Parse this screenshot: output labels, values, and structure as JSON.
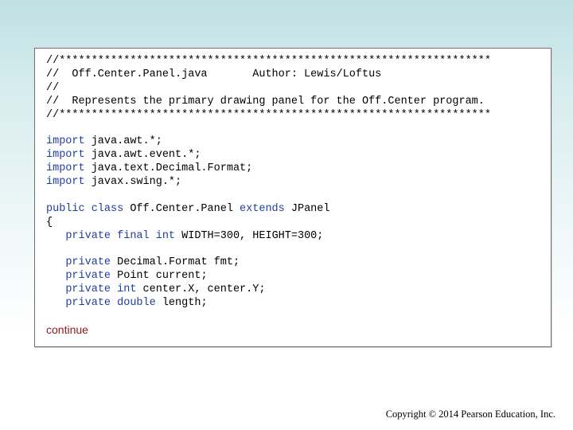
{
  "code": {
    "lines": [
      [
        {
          "t": "//*******************************************************************"
        }
      ],
      [
        {
          "t": "//  Off.Center.Panel.java       Author: Lewis/Loftus"
        }
      ],
      [
        {
          "t": "//"
        }
      ],
      [
        {
          "t": "//  Represents the primary drawing panel for the Off.Center program."
        }
      ],
      [
        {
          "t": "//*******************************************************************"
        }
      ],
      [],
      [
        {
          "t": "import",
          "kw": true
        },
        {
          "t": " java.awt.*;"
        }
      ],
      [
        {
          "t": "import",
          "kw": true
        },
        {
          "t": " java.awt.event.*;"
        }
      ],
      [
        {
          "t": "import",
          "kw": true
        },
        {
          "t": " java.text.Decimal.Format;"
        }
      ],
      [
        {
          "t": "import",
          "kw": true
        },
        {
          "t": " javax.swing.*;"
        }
      ],
      [],
      [
        {
          "t": "public class",
          "kw": true
        },
        {
          "t": " Off.Center.Panel "
        },
        {
          "t": "extends",
          "kw": true
        },
        {
          "t": " JPanel"
        }
      ],
      [
        {
          "t": "{"
        }
      ],
      [
        {
          "t": "   "
        },
        {
          "t": "private final int",
          "kw": true
        },
        {
          "t": " WIDTH=300, HEIGHT=300;"
        }
      ],
      [],
      [
        {
          "t": "   "
        },
        {
          "t": "private",
          "kw": true
        },
        {
          "t": " Decimal.Format fmt;"
        }
      ],
      [
        {
          "t": "   "
        },
        {
          "t": "private",
          "kw": true
        },
        {
          "t": " Point current;"
        }
      ],
      [
        {
          "t": "   "
        },
        {
          "t": "private int",
          "kw": true
        },
        {
          "t": " center.X, center.Y;"
        }
      ],
      [
        {
          "t": "   "
        },
        {
          "t": "private double",
          "kw": true
        },
        {
          "t": " length;"
        }
      ]
    ]
  },
  "continue_label": "continue",
  "copyright": "Copyright © 2014 Pearson Education, Inc.",
  "colors": {
    "keyword": "#1f3f9f",
    "continue": "#8b1a1a",
    "background_top": "#bfe0e2",
    "panel_border": "#6f6f6f"
  }
}
